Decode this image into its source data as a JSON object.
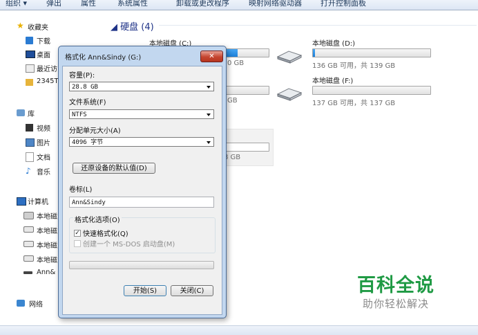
{
  "toolbar": {
    "organize": "组织 ▾",
    "eject": "弹出",
    "properties": "属性",
    "system_properties": "系统属性",
    "uninstall": "卸载或更改程序",
    "map_drive": "映射网络驱动器",
    "control_panel": "打开控制面板"
  },
  "nav": {
    "favorites": "收藏夹",
    "downloads": "下载",
    "desktop": "桌面",
    "recent": "最近访",
    "folder_2345": "2345T",
    "libraries": "库",
    "videos": "视频",
    "pictures": "图片",
    "documents": "文档",
    "music": "音乐",
    "computer": "计算机",
    "local1": "本地磁",
    "local2": "本地磁",
    "local3": "本地磁",
    "local4": "本地磁",
    "usb": "Ann&",
    "network": "网络"
  },
  "content": {
    "group_title": "◢ 硬盘 (4)",
    "drive_c": {
      "name": "本地磁盘 (C:)",
      "info": "0 GB",
      "used_fraction": 0.35
    },
    "drive_d": {
      "name": "本地磁盘 (D:)",
      "info": "136 GB 可用，共 139 GB",
      "used_fraction": 0.02
    },
    "drive_e": {
      "info": "GB"
    },
    "drive_f": {
      "name": "本地磁盘 (F:)",
      "info": "137 GB 可用，共 137 GB",
      "used_fraction": 0.0
    },
    "drive_g": {
      "info": "8 GB"
    }
  },
  "dialog": {
    "title": "格式化 Ann&Sindy (G:)",
    "close": "✕",
    "capacity_label": "容量(P):",
    "capacity_value": "28.8 GB",
    "filesystem_label": "文件系统(F)",
    "filesystem_value": "NTFS",
    "alloc_label": "分配单元大小(A)",
    "alloc_value": "4096 字节",
    "restore_button": "还原设备的默认值(D)",
    "volume_label": "卷标(L)",
    "volume_value": "Ann&Sindy",
    "format_options": "格式化选项(O)",
    "quick_format": "快速格式化(Q)",
    "quick_checked": true,
    "msdos_disk": "创建一个 MS-DOS 启动盘(M)",
    "start_button": "开始(S)",
    "close_button": "关闭(C)"
  },
  "watermark": {
    "title": "百科全说",
    "subtitle": "助你轻松解决"
  },
  "colors": {
    "accent": "#1c7fd8",
    "watermark_green": "#1f9a44",
    "close_red": "#c54530"
  }
}
